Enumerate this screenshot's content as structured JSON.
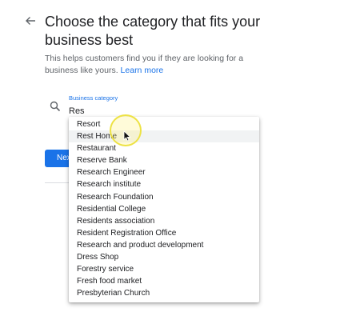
{
  "page": {
    "title": "Choose the category that fits your business best",
    "description": "This helps customers find you if they are looking for a business like yours.",
    "learn_more": "Learn more"
  },
  "field": {
    "label": "Business category",
    "value": "Res"
  },
  "next_button": {
    "label": "Next"
  },
  "dropdown": {
    "hovered_index": 1,
    "items": [
      "Resort",
      "Rest Home",
      "Restaurant",
      "Reserve Bank",
      "Research Engineer",
      "Research institute",
      "Research Foundation",
      "Residential College",
      "Residents association",
      "Resident Registration Office",
      "Research and product development",
      "Dress Shop",
      "Forestry service",
      "Fresh food market",
      "Presbyterian Church"
    ]
  },
  "icons": {
    "back": "arrow-left-icon",
    "search": "search-icon",
    "pointer": "mouse-pointer-icon"
  },
  "colors": {
    "accent": "#1a73e8",
    "highlight_ring": "#ece03c"
  }
}
